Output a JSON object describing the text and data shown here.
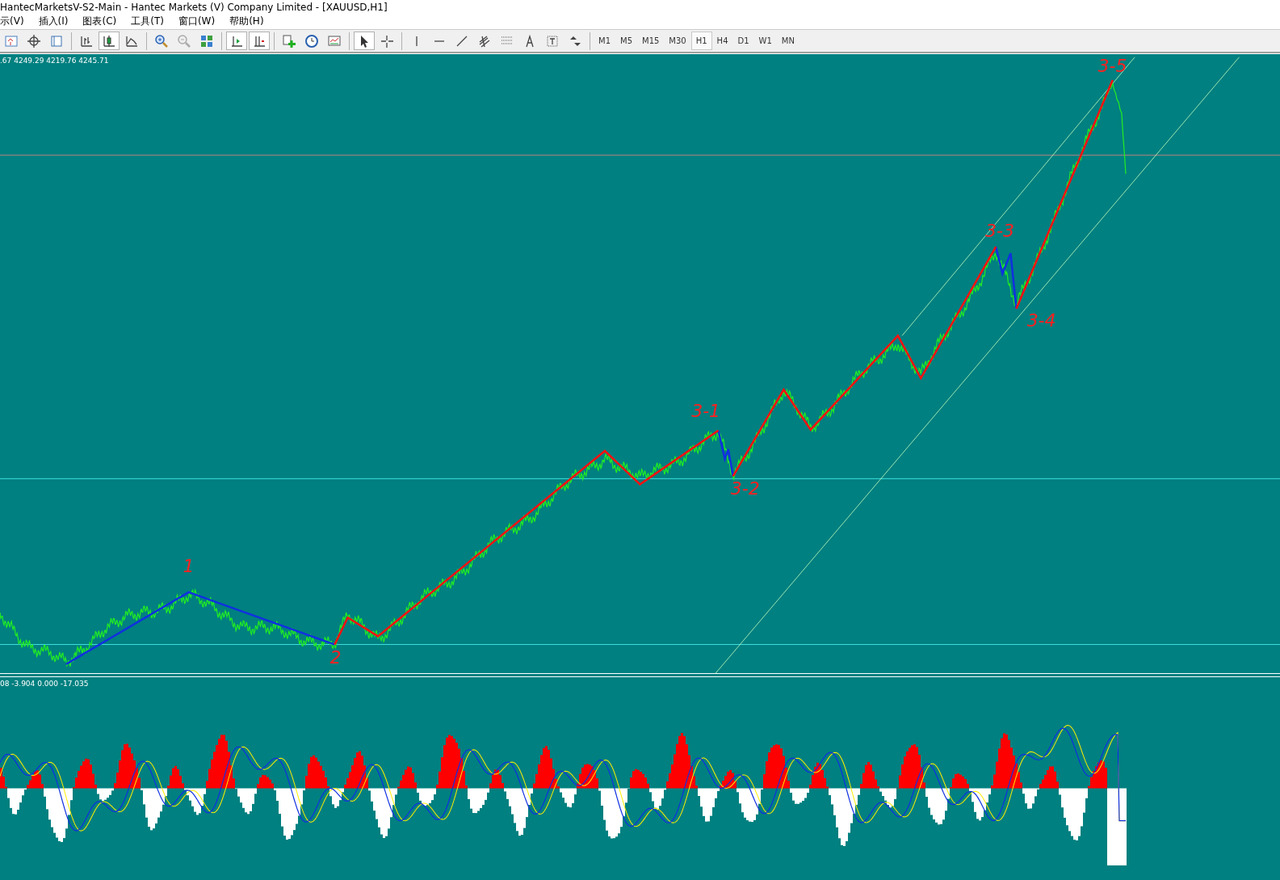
{
  "window": {
    "title": "HantecMarketsV-S2-Main - Hantec Markets (V) Company Limited - [XAUUSD,H1]"
  },
  "menu": [
    "示(V)",
    "插入(I)",
    "图表(C)",
    "工具(T)",
    "窗口(W)",
    "帮助(H)"
  ],
  "toolbar": [
    {
      "kind": "profiles",
      "pressed": false
    },
    {
      "kind": "crosshair",
      "pressed": false
    },
    {
      "kind": "navigator",
      "pressed": false
    },
    {
      "kind": "separator"
    },
    {
      "kind": "bars",
      "pressed": false
    },
    {
      "kind": "candles",
      "pressed": true
    },
    {
      "kind": "line",
      "pressed": false
    },
    {
      "kind": "separator"
    },
    {
      "kind": "zoom-in",
      "pressed": false
    },
    {
      "kind": "zoom-out",
      "pressed": false
    },
    {
      "kind": "tile",
      "pressed": false
    },
    {
      "kind": "separator"
    },
    {
      "kind": "autoscroll",
      "pressed": true
    },
    {
      "kind": "shift",
      "pressed": true
    },
    {
      "kind": "separator"
    },
    {
      "kind": "add",
      "pressed": false
    },
    {
      "kind": "clock",
      "pressed": false
    },
    {
      "kind": "template",
      "pressed": false
    },
    {
      "kind": "separator"
    },
    {
      "kind": "cursor",
      "pressed": true
    },
    {
      "kind": "cross",
      "pressed": false
    },
    {
      "kind": "separator"
    },
    {
      "kind": "vline",
      "pressed": false
    },
    {
      "kind": "hline",
      "pressed": false
    },
    {
      "kind": "trend",
      "pressed": false
    },
    {
      "kind": "fibo",
      "pressed": false
    },
    {
      "kind": "grid",
      "pressed": false
    },
    {
      "kind": "text",
      "pressed": false
    },
    {
      "kind": "label",
      "pressed": false
    },
    {
      "kind": "arrows",
      "pressed": false
    },
    {
      "kind": "separator"
    }
  ],
  "timeframes": [
    {
      "label": "M1",
      "selected": false
    },
    {
      "label": "M5",
      "selected": false
    },
    {
      "label": "M15",
      "selected": false
    },
    {
      "label": "M30",
      "selected": false
    },
    {
      "label": "H1",
      "selected": true
    },
    {
      "label": "H4",
      "selected": false
    },
    {
      "label": "D1",
      "selected": false
    },
    {
      "label": "W1",
      "selected": false
    },
    {
      "label": "MN",
      "selected": false
    }
  ],
  "chart": {
    "ohlc": ".67 4249.29 4219.76 4245.71",
    "wave_labels": [
      {
        "text": "1"
      },
      {
        "text": "2"
      },
      {
        "text": "3-1"
      },
      {
        "text": "3-2"
      },
      {
        "text": "3-3"
      },
      {
        "text": "3-4"
      },
      {
        "text": "3-5"
      }
    ]
  },
  "indicator": {
    "values": "08 -3.904 0.000 -17.035"
  }
}
